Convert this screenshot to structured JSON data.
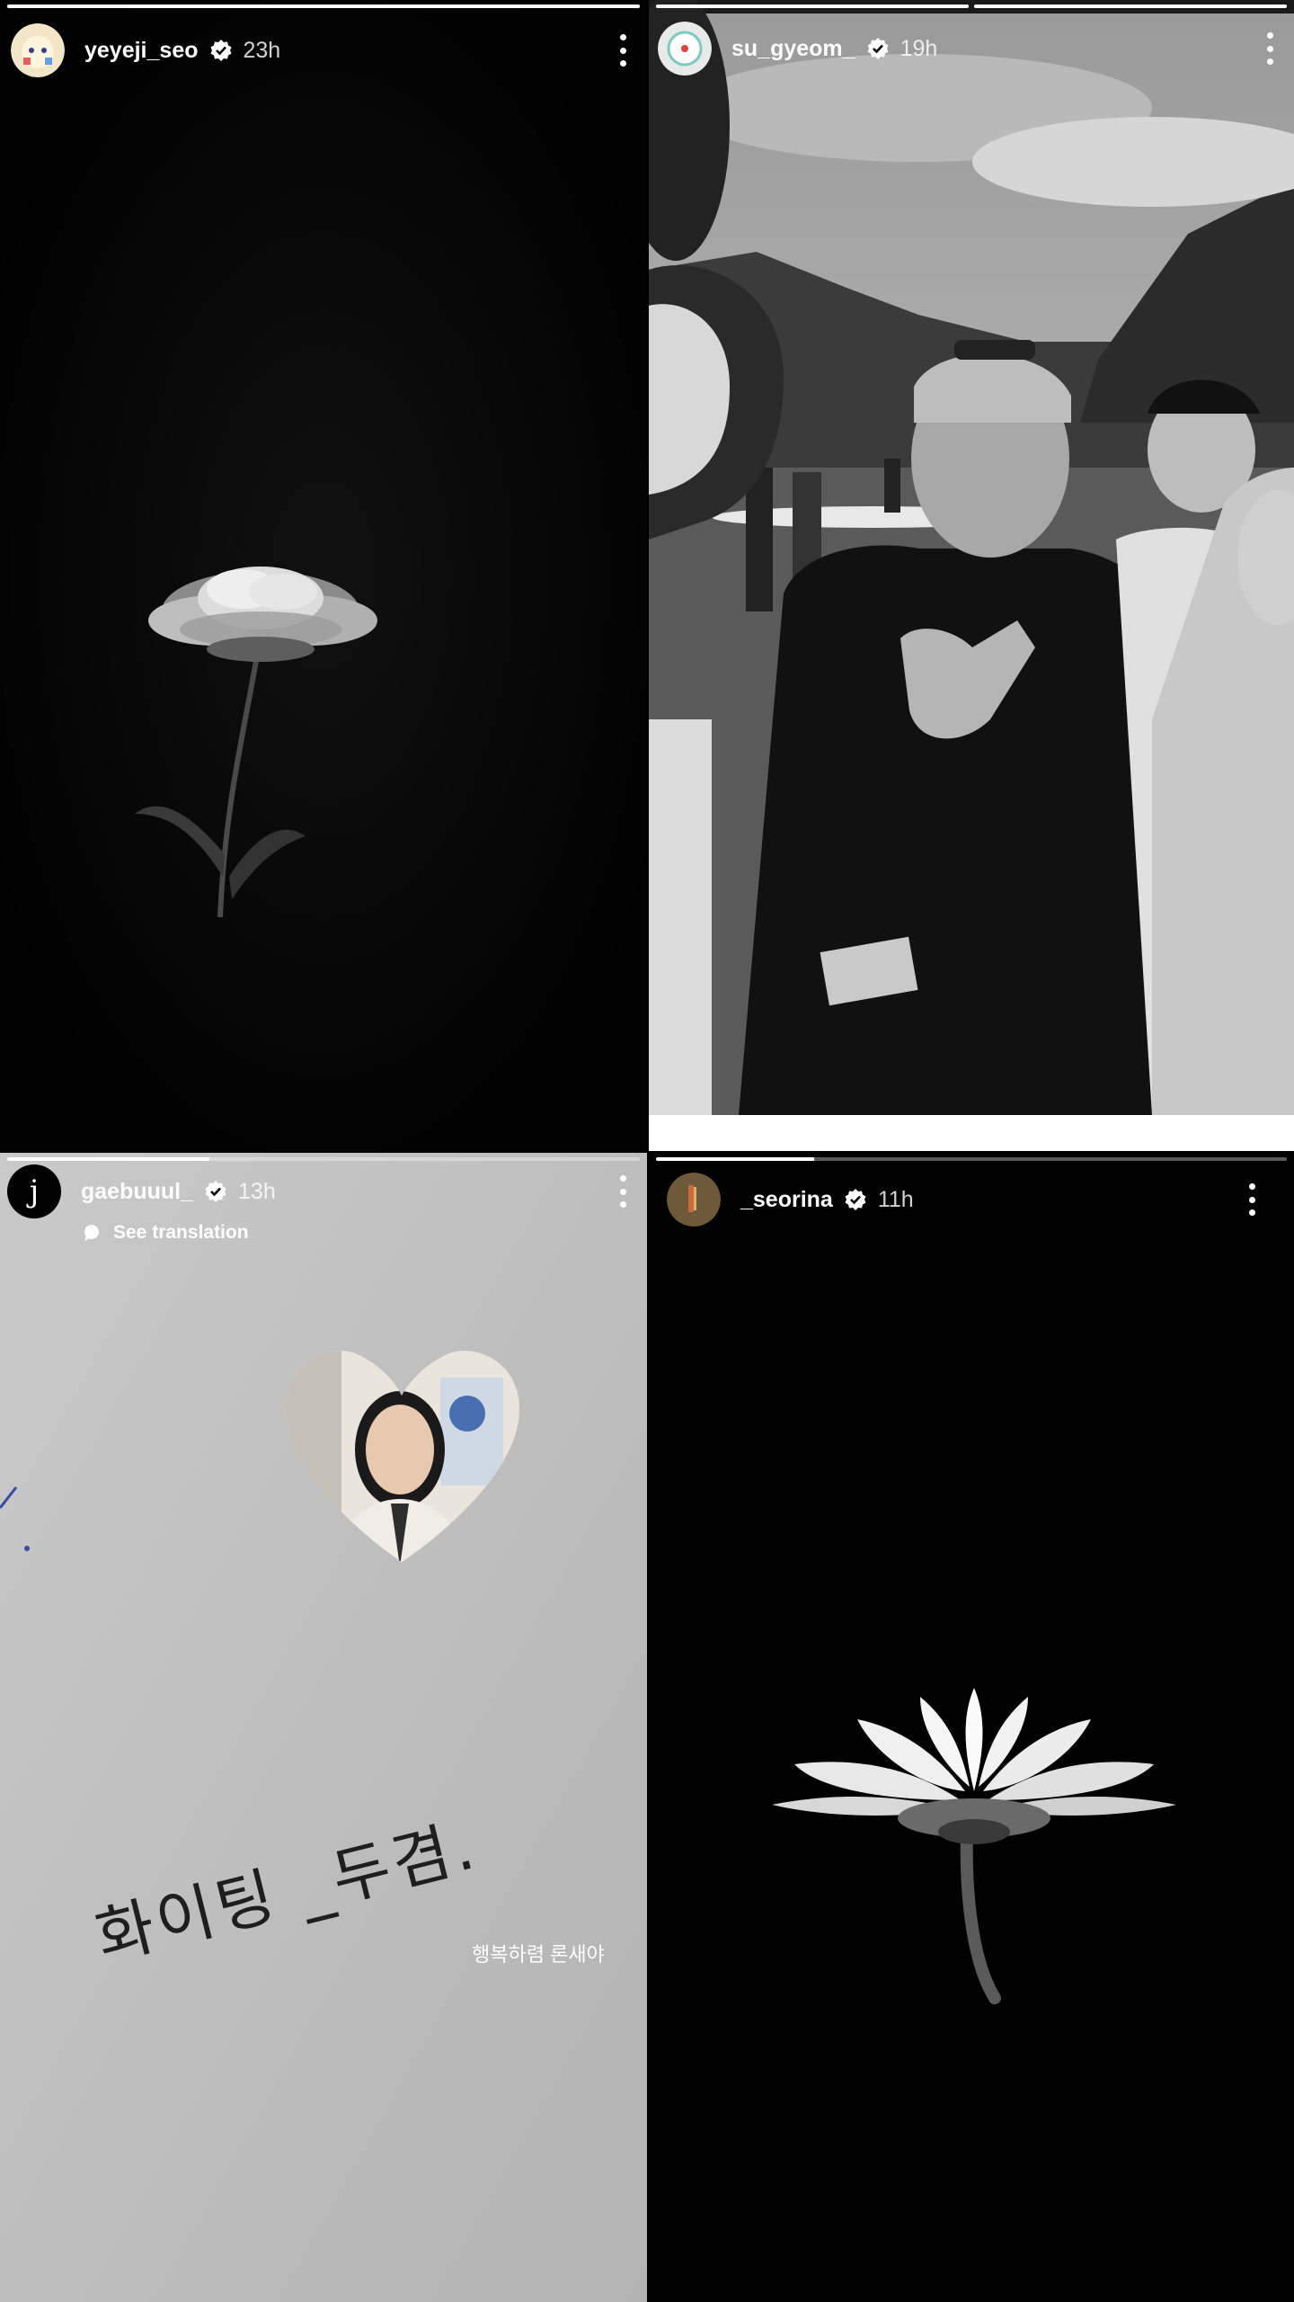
{
  "stories": [
    {
      "username": "yeyeji_seo",
      "time": "23h",
      "verified": true,
      "progress": [
        1.0
      ]
    },
    {
      "username": "su_gyeom_",
      "time": "19h",
      "verified": true,
      "progress": [
        1.0,
        1.0
      ]
    },
    {
      "username": "gaebuuul_",
      "time": "13h",
      "verified": true,
      "avatar_letter": "j",
      "translation_label": "See translation",
      "handwritten_text": "화이팅 _두겸.",
      "caption": "행복하렴 론새야",
      "progress": [
        0.32
      ]
    },
    {
      "username": "_seorina",
      "time": "11h",
      "verified": true,
      "progress": [
        0.25
      ]
    }
  ],
  "colors": {
    "verified_badge": "#ffffff",
    "progress_track": "rgba(255,255,255,0.35)",
    "progress_fill": "#ffffff"
  }
}
